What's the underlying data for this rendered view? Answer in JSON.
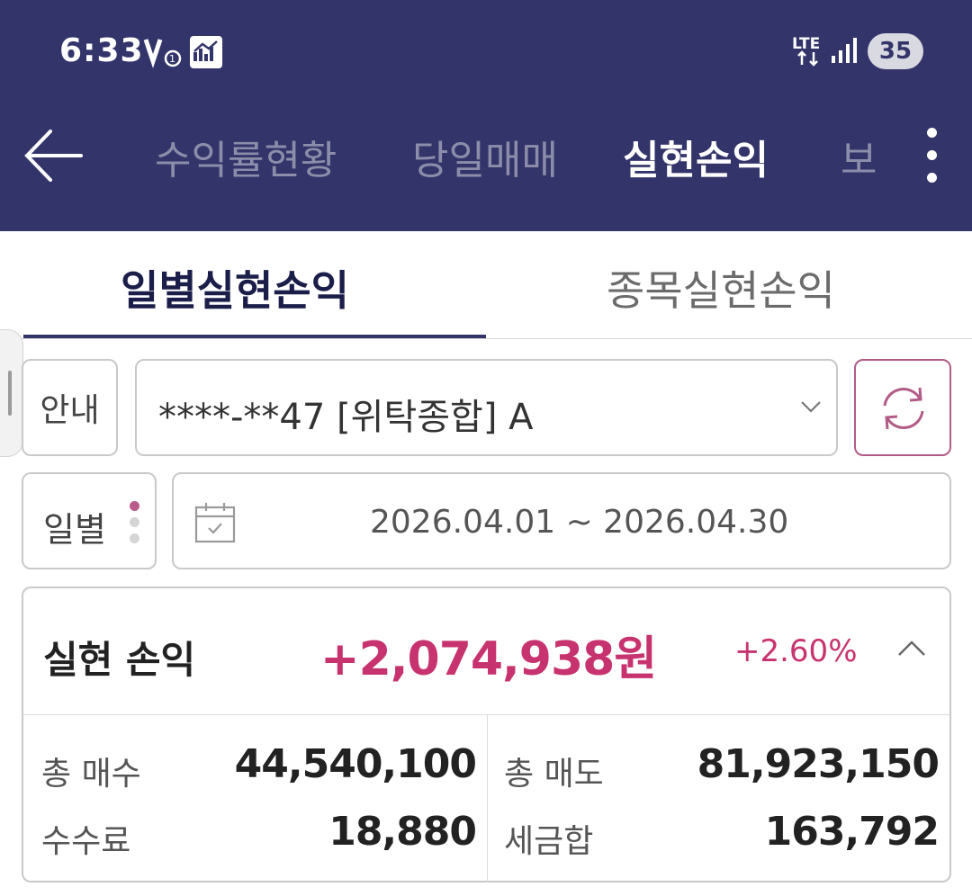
{
  "status_bar": {
    "time": "6:33",
    "network": "LTE",
    "battery": "35"
  },
  "header": {
    "tabs": [
      {
        "label": "수익률현황",
        "active": false
      },
      {
        "label": "당일매매",
        "active": false
      },
      {
        "label": "실현손익",
        "active": true
      },
      {
        "label": "보",
        "active": false
      }
    ],
    "icons": [
      "back-arrow-icon",
      "more-vertical-icon"
    ]
  },
  "subtabs": [
    {
      "label": "일별실현손익",
      "active": true
    },
    {
      "label": "종목실현손익",
      "active": false
    }
  ],
  "controls": {
    "info_label": "안내",
    "account": "****-**47 [위탁종합] A",
    "period": "일별",
    "date_range": "2026.04.01 ~ 2026.04.30"
  },
  "summary": {
    "pnl_label": "실현 손익",
    "pnl_value": "+2,074,938원",
    "pnl_rate": "+2.60%",
    "stats": [
      {
        "label": "총 매수",
        "value": "44,540,100"
      },
      {
        "label": "총 매도",
        "value": "81,923,150"
      },
      {
        "label": "수수료",
        "value": "18,880"
      },
      {
        "label": "세금합",
        "value": "163,792"
      }
    ]
  },
  "colors": {
    "header_bg": "#33346a",
    "accent": "#c7336e",
    "active_subtab": "#1c1e4a"
  }
}
